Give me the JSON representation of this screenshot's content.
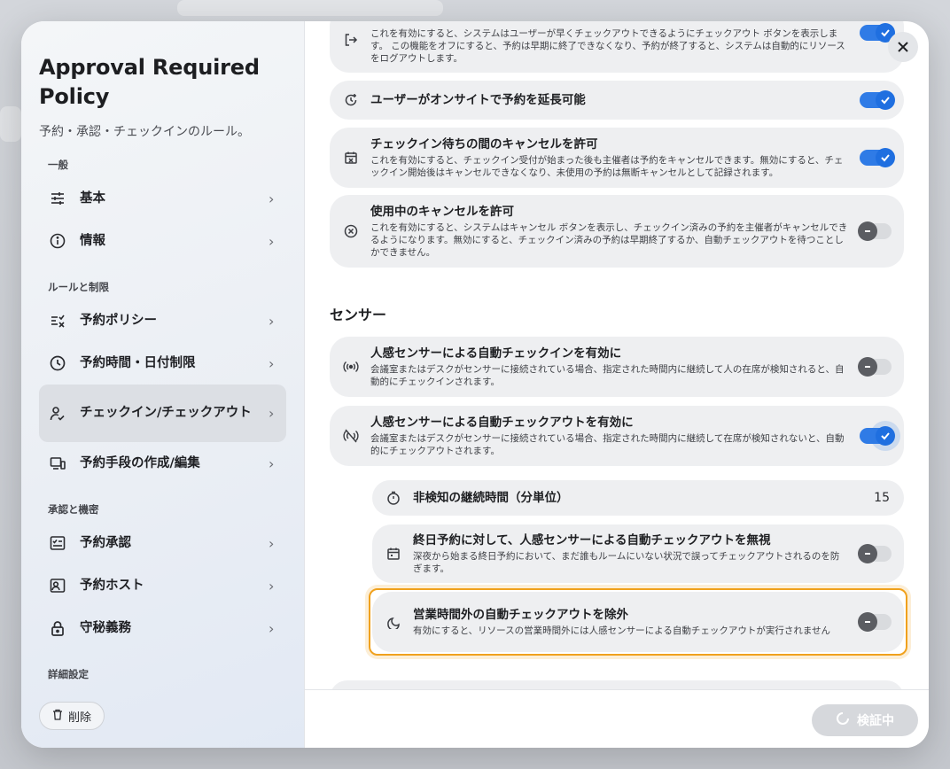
{
  "sidebar": {
    "title": "Approval Required Policy",
    "subtitle": "予約・承認・チェックインのルール。",
    "sections": [
      {
        "label": "一般",
        "items": [
          {
            "label": "基本",
            "icon": "sliders-icon"
          },
          {
            "label": "情報",
            "icon": "info-icon"
          }
        ]
      },
      {
        "label": "ルールと制限",
        "items": [
          {
            "label": "予約ポリシー",
            "icon": "list-check-icon"
          },
          {
            "label": "予約時間・日付制限",
            "icon": "clock-icon"
          },
          {
            "label": "チェックイン/チェックアウト",
            "icon": "person-check-icon",
            "active": true
          },
          {
            "label": "予約手段の作成/編集",
            "icon": "devices-icon"
          }
        ]
      },
      {
        "label": "承認と機密",
        "items": [
          {
            "label": "予約承認",
            "icon": "checklist-icon"
          },
          {
            "label": "予約ホスト",
            "icon": "host-icon"
          },
          {
            "label": "守秘義務",
            "icon": "lock-icon"
          }
        ]
      },
      {
        "label": "詳細設定",
        "items": []
      }
    ],
    "delete_label": "削除"
  },
  "main": {
    "cards_top": [
      {
        "title": "",
        "desc": "これを有効にすると、システムはユーザーが早くチェックアウトできるようにチェックアウト ボタンを表示します。 この機能をオフにすると、予約は早期に終了できなくなり、予約が終了すると、システムは自動的にリソースをログアウトします。",
        "icon": "logout-icon",
        "toggle": "on"
      },
      {
        "title": "ユーザーがオンサイトで予約を延長可能",
        "desc": "",
        "icon": "extend-time-icon",
        "toggle": "on"
      },
      {
        "title": "チェックイン待ちの間のキャンセルを許可",
        "desc": "これを有効にすると、チェックイン受付が始まった後も主催者は予約をキャンセルできます。無効にすると、チェックイン開始後はキャンセルできなくなり、未使用の予約は無断キャンセルとして記録されます。",
        "icon": "calendar-x-icon",
        "toggle": "on"
      },
      {
        "title": "使用中のキャンセルを許可",
        "desc": "これを有効にすると、システムはキャンセル ボタンを表示し、チェックイン済みの予約を主催者がキャンセルできるようになります。無効にすると、チェックイン済みの予約は早期終了するか、自動チェックアウトを待つことしかできません。",
        "icon": "circle-x-icon",
        "toggle": "off"
      }
    ],
    "sensor_heading": "センサー",
    "sensor_cards": [
      {
        "title": "人感センサーによる自動チェックインを有効に",
        "desc": "会議室またはデスクがセンサーに接続されている場合、指定された時間内に継続して人の在席が検知されると、自動的にチェックインされます。",
        "icon": "sensor-icon",
        "toggle": "off"
      },
      {
        "title": "人感センサーによる自動チェックアウトを有効に",
        "desc": "会議室またはデスクがセンサーに接続されている場合、指定された時間内に継続して在席が検知されないと、自動的にチェックアウトされます。",
        "icon": "sensor-off-icon",
        "toggle": "on"
      }
    ],
    "sub_cards": [
      {
        "title": "非検知の継続時間（分単位）",
        "value": "15",
        "icon": "timer-icon"
      },
      {
        "title": "終日予約に対して、人感センサーによる自動チェックアウトを無視",
        "desc": "深夜から始まる終日予約において、まだ誰もルームにいない状況で誤ってチェックアウトされるのを防ぎます。",
        "icon": "calendar-icon",
        "toggle": "off"
      },
      {
        "title": "営業時間外の自動チェックアウトを除外",
        "desc": "有効にすると、リソースの営業時間外には人感センサーによる自動チェックアウトが実行されません",
        "icon": "moon-icon",
        "toggle": "off"
      }
    ]
  },
  "footer": {
    "verify_label": "検証中"
  },
  "colors": {
    "accent": "#1f6fe0",
    "highlight": "#f0a11d"
  }
}
